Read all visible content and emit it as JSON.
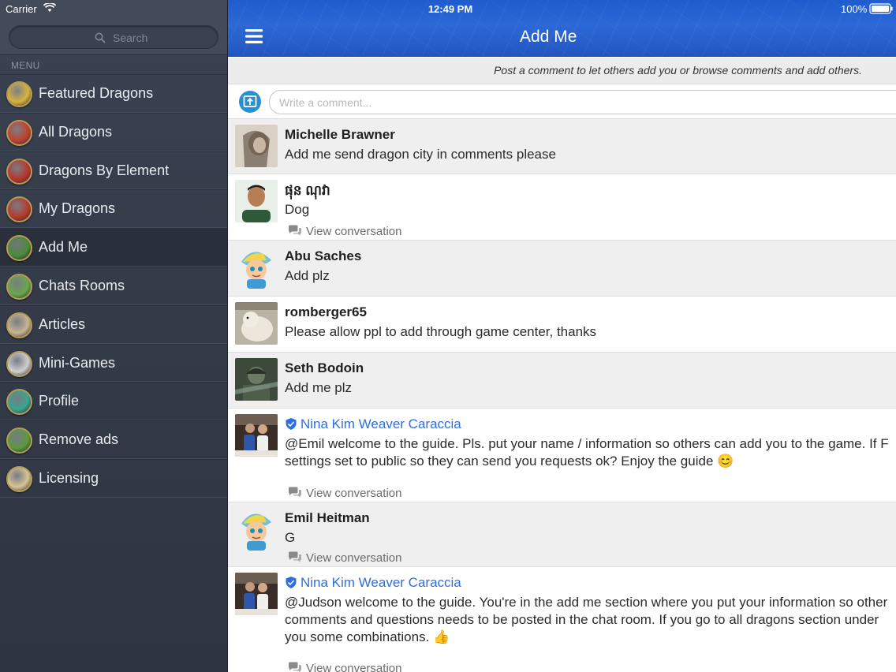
{
  "status": {
    "carrier": "Carrier",
    "time": "12:49 PM",
    "battery": "100%"
  },
  "sidebar": {
    "search_placeholder": "Search",
    "menu_label": "MENU",
    "items": [
      {
        "label": "Featured Dragons",
        "icon": "featured-dragons-icon",
        "color": "#d8b23c"
      },
      {
        "label": "All Dragons",
        "icon": "all-dragons-icon",
        "color": "#c0412e"
      },
      {
        "label": "Dragons By Element",
        "icon": "element-icon",
        "color": "#b8362b"
      },
      {
        "label": "My Dragons",
        "icon": "my-dragons-icon",
        "color": "#b73a2a"
      },
      {
        "label": "Add Me",
        "icon": "add-me-icon",
        "color": "#4d8a3a"
      },
      {
        "label": "Chats Rooms",
        "icon": "chat-rooms-icon",
        "color": "#69a84a"
      },
      {
        "label": "Articles",
        "icon": "articles-icon",
        "color": "#c9b48e"
      },
      {
        "label": "Mini-Games",
        "icon": "mini-games-icon",
        "color": "#cfcfcf"
      },
      {
        "label": "Profile",
        "icon": "profile-icon",
        "color": "#3aa58f"
      },
      {
        "label": "Remove ads",
        "icon": "remove-ads-icon",
        "color": "#5c9a3e"
      },
      {
        "label": "Licensing",
        "icon": "licensing-icon",
        "color": "#d7c497"
      }
    ],
    "active_index": 4
  },
  "main": {
    "title": "Add Me",
    "subheader": "Post a comment to let others add you or browse comments and add others.",
    "comment_placeholder": "Write a comment...",
    "view_conversation": "View conversation",
    "comments": [
      {
        "name": "Michelle Brawner",
        "text": "Add me send dragon city in comments please",
        "avatar": "photo-woman",
        "verified": false,
        "view_conversation": false
      },
      {
        "name": "ផុន ណុវា",
        "text": "Dog",
        "avatar": "photo-man",
        "verified": false,
        "view_conversation": true
      },
      {
        "name": "Abu Saches",
        "text": "Add plz",
        "avatar": "cartoon-boy",
        "verified": false,
        "view_conversation": false
      },
      {
        "name": "romberger65",
        "text": "Please allow ppl to add through game center, thanks",
        "avatar": "photo-bear",
        "verified": false,
        "view_conversation": false
      },
      {
        "name": "Seth Bodoin",
        "text": "Add me plz",
        "avatar": "photo-soldier",
        "verified": false,
        "view_conversation": false
      },
      {
        "name": "Nina Kim Weaver Caraccia",
        "text": "@Emil welcome to the guide. Pls. put your name / information so others can add you to the game. If F\nsettings set to public so they can send you requests ok? Enjoy the guide 😊",
        "avatar": "photo-couple",
        "verified": true,
        "view_conversation": true
      },
      {
        "name": "Emil Heitman",
        "text": "G",
        "avatar": "cartoon-boy",
        "verified": false,
        "view_conversation": true
      },
      {
        "name": "Nina Kim Weaver Caraccia",
        "text": "@Judson welcome to the guide. You're in the add me section where you put your information so other\ncomments and questions needs to be posted in the chat room. If you go to all dragons section under\nyou some combinations. 👍",
        "avatar": "photo-couple",
        "verified": true,
        "view_conversation": true
      }
    ]
  },
  "colors": {
    "nav_blue": "#2c69d6",
    "link_blue": "#2e6ee0",
    "sidebar_bg": "#343b49"
  }
}
